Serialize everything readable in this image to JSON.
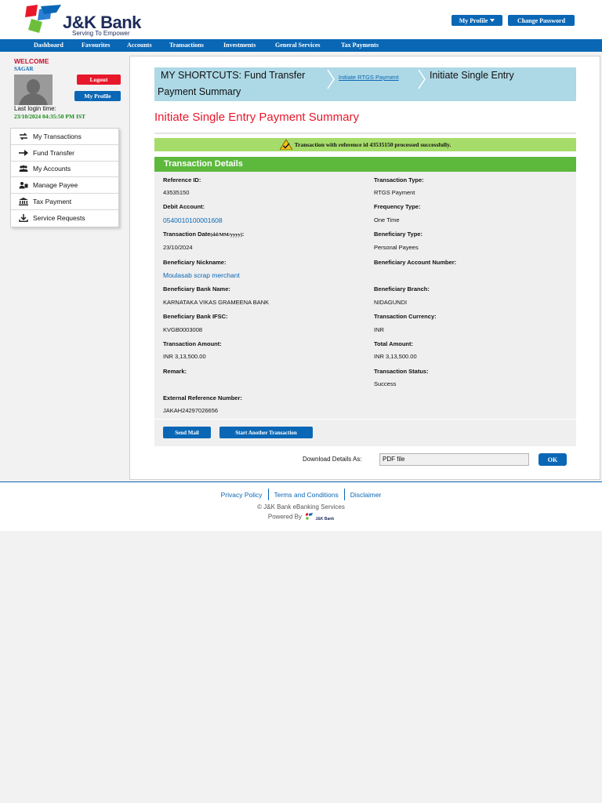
{
  "brand": {
    "logo_text": "J&K Bank",
    "tagline": "Serving To Empower",
    "colors": {
      "primary": "#0a67b5",
      "accent_red": "#e8182b",
      "success_green": "#5cb93c",
      "success_bar": "#a6dc6a",
      "shortcut_bg": "#add8e6"
    }
  },
  "header": {
    "my_profile": "My Profile",
    "change_password": "Change Password"
  },
  "nav": {
    "items": [
      "Dashboard",
      "Favourites",
      "Accounts",
      "Transactions",
      "Investments",
      "General Services",
      "Tax Payments"
    ]
  },
  "sidebar": {
    "welcome": "WELCOME",
    "username": "SAGAR",
    "logout": "Logout",
    "my_profile": "My Profile",
    "last_login_label": "Last login time:",
    "last_login_time": "23/10/2024 04:35:50 PM IST",
    "menu": [
      {
        "label": "My Transactions",
        "icon": "transfer-arrows-icon"
      },
      {
        "label": "Fund Transfer",
        "icon": "arrow-right-icon"
      },
      {
        "label": "My Accounts",
        "icon": "users-icon"
      },
      {
        "label": "Manage Payee",
        "icon": "payee-icon"
      },
      {
        "label": "Tax Payment",
        "icon": "bank-building-icon"
      },
      {
        "label": "Service Requests",
        "icon": "download-icon"
      }
    ]
  },
  "shortcuts": {
    "label": "MY SHORTCUTS:  Fund Transfer",
    "link": "Initiate RTGS Payment",
    "current_line1": "Initiate Single Entry",
    "current_line2": "Payment Summary"
  },
  "page_title": "Initiate Single Entry Payment Summary",
  "success_message": "Transaction with reference id 43535150 processed successfully.",
  "details": {
    "header": "Transaction Details",
    "reference_id": {
      "label": "Reference ID:",
      "value": "43535150"
    },
    "transaction_type": {
      "label": "Transaction Type:",
      "value": "RTGS Payment"
    },
    "debit_account": {
      "label": "Debit Account:",
      "value": "0540010100001608"
    },
    "frequency_type": {
      "label": "Frequency Type:",
      "value": "One Time"
    },
    "transaction_date": {
      "label": "Transaction Date",
      "format": "(dd/MM/yyyy)",
      "colon": ":",
      "value": "23/10/2024"
    },
    "beneficiary_type": {
      "label": "Beneficiary Type:",
      "value": "Personal Payees"
    },
    "beneficiary_nickname": {
      "label": "Beneficiary Nickname:",
      "value": "Moulasab scrap merchant"
    },
    "beneficiary_account_number": {
      "label": "Beneficiary Account Number:",
      "value": ""
    },
    "beneficiary_bank_name": {
      "label": "Beneficiary Bank Name:",
      "value": "KARNATAKA VIKAS GRAMEENA BANK"
    },
    "beneficiary_branch": {
      "label": "Beneficiary Branch:",
      "value": "NIDAGUNDI"
    },
    "beneficiary_bank_ifsc": {
      "label": "Beneficiary Bank IFSC:",
      "value": "KVGB0003008"
    },
    "transaction_currency": {
      "label": "Transaction Currency:",
      "value": "INR"
    },
    "transaction_amount": {
      "label": "Transaction Amount:",
      "value": "INR 3,13,500.00"
    },
    "total_amount": {
      "label": "Total Amount:",
      "value": "INR 3,13,500.00"
    },
    "remark": {
      "label": "Remark:",
      "value": ""
    },
    "transaction_status": {
      "label": "Transaction Status:",
      "value": "Success"
    },
    "external_reference_number": {
      "label": "External Reference Number:",
      "value": "JAKAH24297026656"
    }
  },
  "actions": {
    "send_mail": "Send Mail",
    "start_another": "Start Another Transaction"
  },
  "download": {
    "label": "Download Details As:",
    "selected": "PDF file",
    "ok": "OK"
  },
  "footer": {
    "links": [
      "Privacy Policy",
      "Terms and Conditions",
      "Disclaimer"
    ],
    "copyright": "© J&K Bank eBanking Services",
    "powered_by": "Powered By"
  }
}
